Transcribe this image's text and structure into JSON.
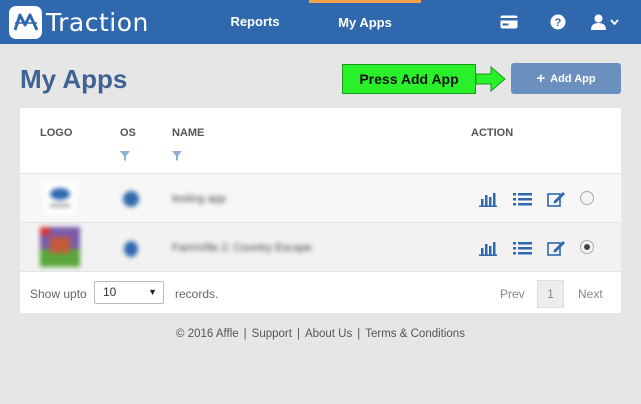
{
  "brand": {
    "name": "Traction"
  },
  "nav": {
    "reports": "Reports",
    "my_apps": "My Apps"
  },
  "page": {
    "title": "My Apps"
  },
  "callout": {
    "text": "Press Add App"
  },
  "add_button": {
    "label": "Add App"
  },
  "table": {
    "headers": {
      "logo": "LOGO",
      "os": "OS",
      "name": "NAME",
      "action": "ACTION"
    },
    "rows": [
      {
        "name": "testing app",
        "selected": false
      },
      {
        "name": "FarmVille 2: Country Escape",
        "selected": true
      }
    ]
  },
  "pagination": {
    "show_label": "Show upto",
    "page_size": "10",
    "records_label": "records.",
    "prev": "Prev",
    "current_page": "1",
    "next": "Next"
  },
  "footer": {
    "copyright": "© 2016 Affle",
    "support": "Support",
    "about": "About Us",
    "terms": "Terms & Conditions"
  },
  "colors": {
    "navbar": "#2f68ad",
    "accent": "#f5a04a",
    "title": "#3f6294",
    "callout": "#29f02b",
    "button": "#6b8fbe",
    "action_icon": "#2f68ad"
  },
  "icons": [
    "logo-icon",
    "credit-card-icon",
    "help-icon",
    "user-icon",
    "filter-icon",
    "android-icon",
    "apple-icon",
    "bar-chart-icon",
    "list-icon",
    "edit-icon"
  ]
}
